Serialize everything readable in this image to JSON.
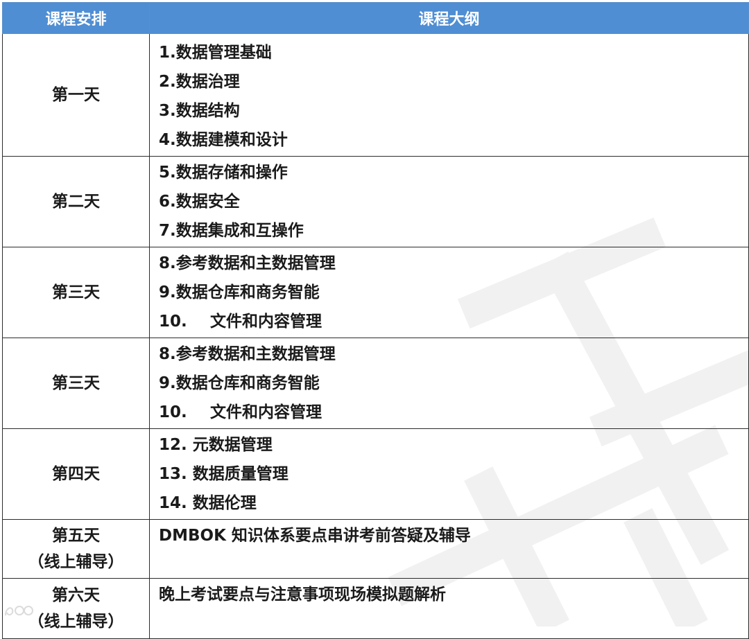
{
  "header": {
    "col_schedule": "课程安排",
    "col_outline": "课程大纲"
  },
  "rows": [
    {
      "day": "第一天",
      "items": [
        {
          "text": "1.数据管理基础"
        },
        {
          "text": "2.数据治理"
        },
        {
          "text": "3.数据结构"
        },
        {
          "text": "4.数据建模和设计"
        }
      ]
    },
    {
      "day": "第二天",
      "items": [
        {
          "text": "5.数据存储和操作"
        },
        {
          "text": "6.数据安全"
        },
        {
          "text": "7.数据集成和互操作"
        }
      ]
    },
    {
      "day": "第三天",
      "items": [
        {
          "text": "8.参考数据和主数据管理"
        },
        {
          "text": "9.数据仓库和商务智能"
        },
        {
          "num": "10.",
          "text": "文件和内容管理"
        }
      ]
    },
    {
      "day": "第三天",
      "items": [
        {
          "text": "8.参考数据和主数据管理"
        },
        {
          "text": "9.数据仓库和商务智能"
        },
        {
          "num": "10.",
          "text": "文件和内容管理"
        }
      ]
    },
    {
      "day": "第四天",
      "items": [
        {
          "text": "12. 元数据管理"
        },
        {
          "text": "13. 数据质量管理"
        },
        {
          "text": "14. 数据伦理"
        }
      ]
    },
    {
      "day": "第五天",
      "day_note": "（线上辅导）",
      "items": [
        {
          "text": "DMBOK 知识体系要点串讲考前答疑及辅导"
        }
      ]
    },
    {
      "day": "第六天",
      "day_note": "（线上辅导）",
      "items": [
        {
          "text": "晚上考试要点与注意事项现场模拟题解析"
        }
      ]
    }
  ],
  "colors": {
    "header_bg": "#4f8ed3",
    "header_text": "#ffffff",
    "border": "#2b2b2b"
  },
  "icons": {
    "watermark": "watermark-logo-icon",
    "corner": "corner-logo-icon"
  }
}
